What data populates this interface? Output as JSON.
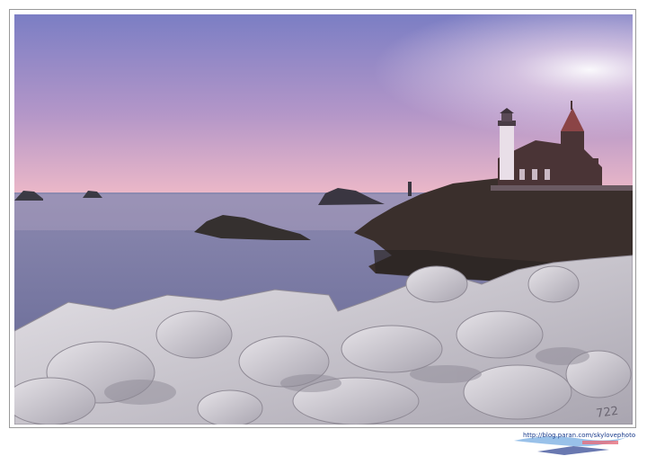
{
  "photo": {
    "subject": "lighthouse-and-church-on-rocky-coast",
    "colors": {
      "sky_top": "#7d7ec5",
      "sky_mid": "#b698c9",
      "sky_horizon": "#e9b7c8",
      "sea": "#6f7097",
      "rock": "#3a302d",
      "tetrapod": "#c9c6cc"
    },
    "block_marking": "722"
  },
  "watermark": {
    "url": "http://blog.paran.com/skylovephoto"
  }
}
